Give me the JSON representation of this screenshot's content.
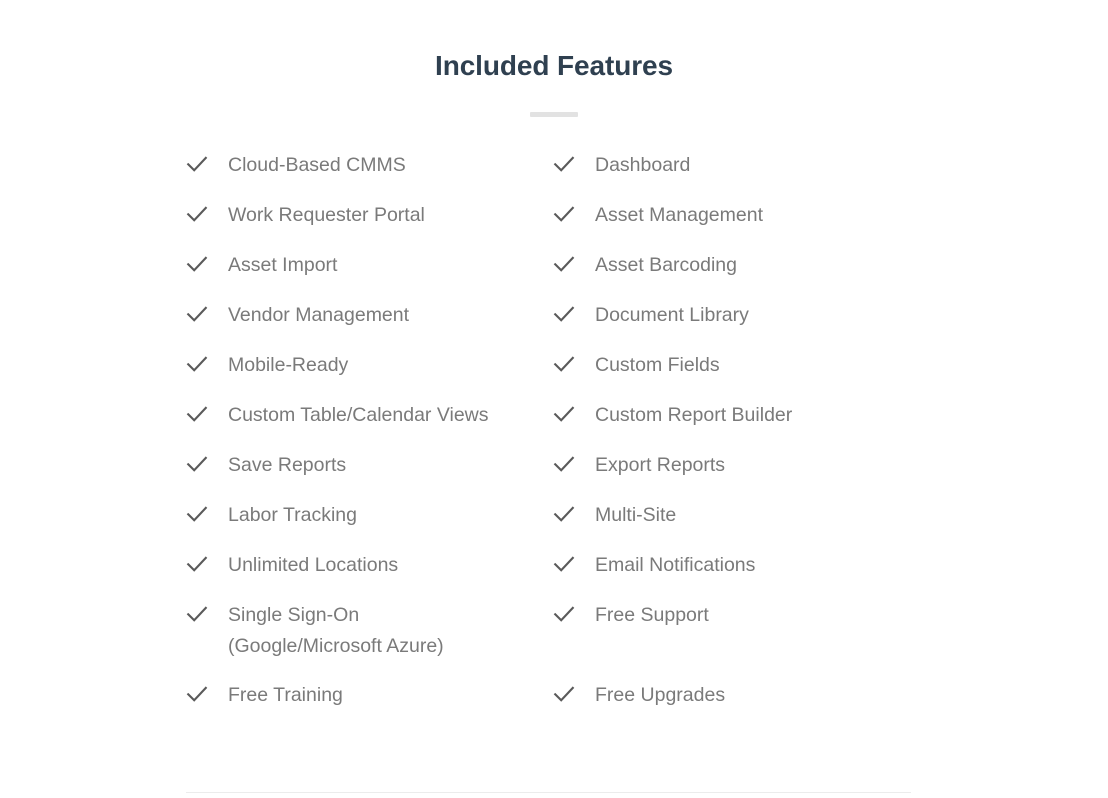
{
  "section": {
    "title": "Included Features",
    "divider_color": "#e2e2e2",
    "title_color": "#2f4050",
    "label_color": "#7a7a7a",
    "check_color": "#5a5a5a",
    "rule_color": "#ececec"
  },
  "columns": {
    "left": [
      {
        "label": "Cloud-Based CMMS",
        "icon": "check-icon",
        "wrapped": false
      },
      {
        "label": "Work Requester Portal",
        "icon": "check-icon",
        "wrapped": false
      },
      {
        "label": "Asset Import",
        "icon": "check-icon",
        "wrapped": false
      },
      {
        "label": "Vendor Management",
        "icon": "check-icon",
        "wrapped": false
      },
      {
        "label": "Mobile-Ready",
        "icon": "check-icon",
        "wrapped": false
      },
      {
        "label": "Custom Table/Calendar Views",
        "icon": "check-icon",
        "wrapped": false
      },
      {
        "label": "Save Reports",
        "icon": "check-icon",
        "wrapped": false
      },
      {
        "label": "Labor Tracking",
        "icon": "check-icon",
        "wrapped": false
      },
      {
        "label": "Unlimited Locations",
        "icon": "check-icon",
        "wrapped": false
      },
      {
        "label": "Single Sign-On\n(Google/Microsoft Azure)",
        "icon": "check-icon",
        "wrapped": true
      },
      {
        "label": "Free Training",
        "icon": "check-icon",
        "wrapped": false
      }
    ],
    "right": [
      {
        "label": "Dashboard",
        "icon": "check-icon",
        "wrapped": false
      },
      {
        "label": "Asset Management",
        "icon": "check-icon",
        "wrapped": false
      },
      {
        "label": "Asset Barcoding",
        "icon": "check-icon",
        "wrapped": false
      },
      {
        "label": "Document Library",
        "icon": "check-icon",
        "wrapped": false
      },
      {
        "label": "Custom Fields",
        "icon": "check-icon",
        "wrapped": false
      },
      {
        "label": "Custom Report Builder",
        "icon": "check-icon",
        "wrapped": false
      },
      {
        "label": "Export Reports",
        "icon": "check-icon",
        "wrapped": false
      },
      {
        "label": "Multi-Site",
        "icon": "check-icon",
        "wrapped": false
      },
      {
        "label": "Email Notifications",
        "icon": "check-icon",
        "wrapped": false
      },
      {
        "label": "Free Support",
        "icon": "check-icon",
        "wrapped": true
      },
      {
        "label": "Free Upgrades",
        "icon": "check-icon",
        "wrapped": false
      }
    ]
  }
}
